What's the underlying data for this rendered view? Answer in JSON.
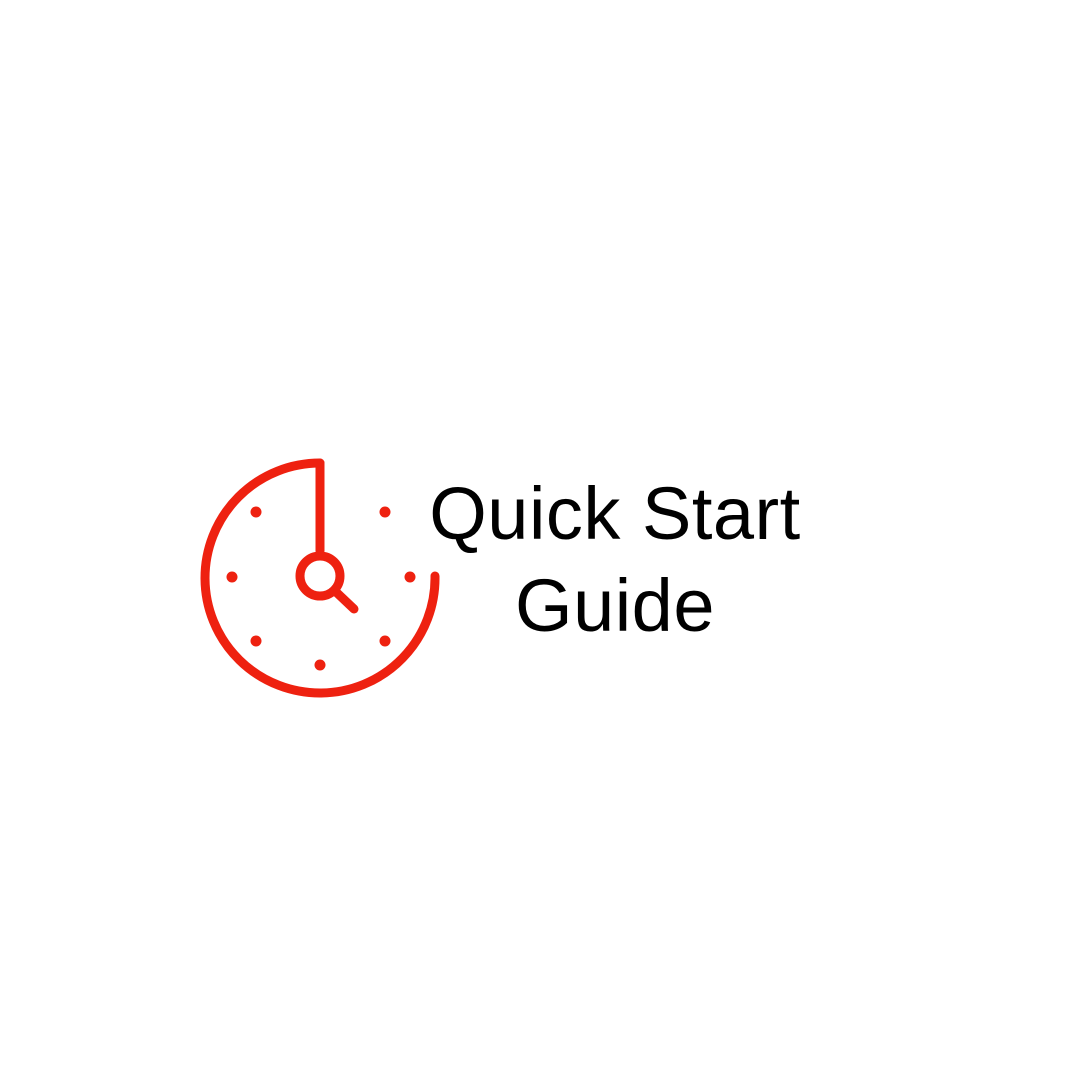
{
  "title": {
    "line1": "Quick Start",
    "line2": "Guide"
  },
  "colors": {
    "accent": "#ee2110",
    "text": "#000000",
    "background": "#ffffff"
  },
  "icon": {
    "name": "clock-icon"
  }
}
